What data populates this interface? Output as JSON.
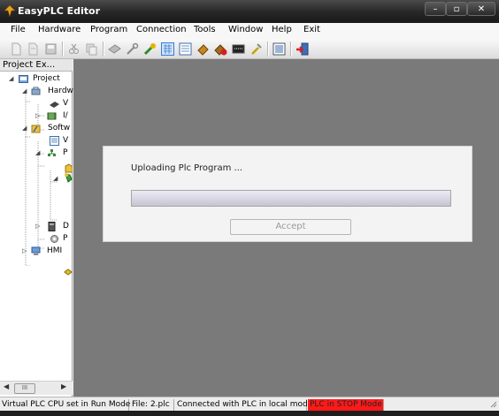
{
  "window": {
    "title": "EasyPLC Editor",
    "controls": {
      "minimize": "–",
      "maximize": "▫",
      "close": "✕"
    }
  },
  "menu": [
    "File",
    "Hardware",
    "Program",
    "Connection",
    "Tools",
    "Window",
    "Help",
    "Exit"
  ],
  "toolbar": {
    "buttons": [
      "new-file-icon",
      "open-file-icon",
      "save-icon",
      "cut-icon",
      "copy-icon",
      "hardware-icon",
      "wrench-icon",
      "connect-icon",
      "grid-icon",
      "monitor-grid-icon",
      "plc-icon",
      "stop-icon",
      "display-icon",
      "tools-icon",
      "window-icon",
      "exit-icon"
    ]
  },
  "project_panel": {
    "title": "Project Ex...",
    "tree": [
      {
        "label": "Project",
        "icon": "project-icon"
      },
      {
        "label": "Hardw",
        "icon": "hardware-folder-icon"
      },
      {
        "label": "V",
        "icon": "virtual-plc-icon"
      },
      {
        "label": "I/",
        "icon": "io-icon"
      },
      {
        "label": "Softw",
        "icon": "software-folder-icon"
      },
      {
        "label": "V",
        "icon": "variables-icon"
      },
      {
        "label": "P",
        "icon": "program-icon"
      },
      {
        "label": "D",
        "icon": "device-icon"
      },
      {
        "label": "P",
        "icon": "plugin-icon"
      },
      {
        "label": "HMI",
        "icon": "hmi-icon"
      }
    ],
    "hscroll_thumb": "III"
  },
  "dialog": {
    "message": "Uploading Plc Program ...",
    "progress": 1.0,
    "accept_label": "Accept"
  },
  "status": {
    "cpu": "Virtual PLC CPU set in Run Mode",
    "file": "File: 2.plc",
    "connection": "Connected with PLC in local mode",
    "plc_state": "PLC in STOP Mode"
  },
  "colors": {
    "stop_bg": "#ff1a1a",
    "workspace": "#7a7a7a",
    "titlebar": "#262626"
  }
}
